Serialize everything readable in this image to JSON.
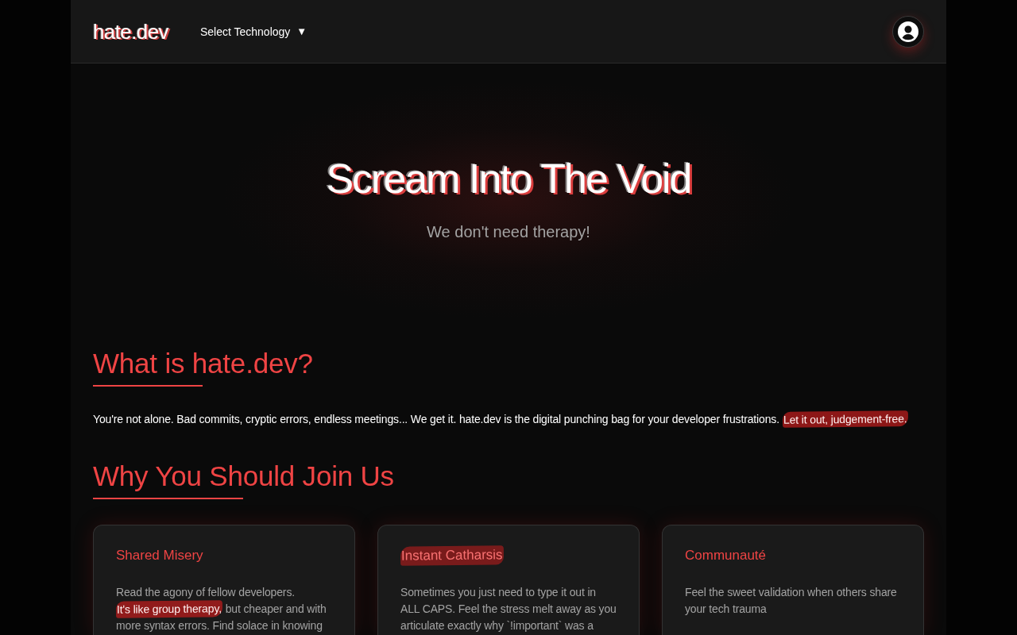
{
  "header": {
    "logo": "hate.dev",
    "technology_select": {
      "label": "Select Technology",
      "caret": "▼"
    }
  },
  "hero": {
    "title": "Scream Into The Void",
    "subtitle": "We don't need therapy!"
  },
  "about": {
    "heading": "What is hate.dev?",
    "text": [
      {
        "text": "You're not alone. Bad commits, cryptic errors, endless meetings... We get it. hate.dev is the digital punching bag for your developer frustrations.",
        "highlighted": false
      },
      {
        "text": "Let it out, judgement-free.",
        "highlighted": true
      }
    ]
  },
  "features": {
    "heading": "Why You Should Join Us",
    "cards": [
      {
        "title": "Shared Misery",
        "title_highlighted": false,
        "text": [
          {
            "text": "Read the agony of fellow developers.",
            "highlighted": false
          },
          {
            "text": "It's like group therapy,",
            "highlighted": true
          },
          {
            "text": "but cheaper and with more syntax errors. Find solace in knowing",
            "highlighted": false
          }
        ]
      },
      {
        "title": "Instant Catharsis",
        "title_highlighted": true,
        "text": [
          {
            "text": "Sometimes you just need to type it out in ALL CAPS. Feel the stress melt away as you articulate exactly why `!important` was a",
            "highlighted": false
          }
        ]
      },
      {
        "title": "Communauté",
        "title_highlighted": false,
        "text": [
          {
            "text": "Feel the sweet validation when others share your tech trauma",
            "highlighted": false
          }
        ]
      }
    ]
  }
}
